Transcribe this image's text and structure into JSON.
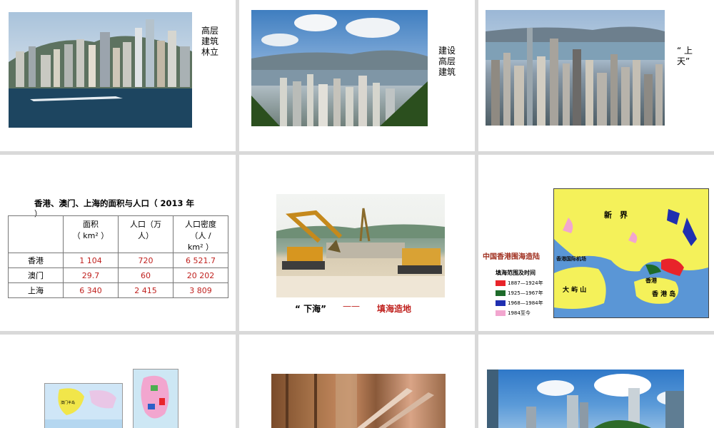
{
  "slide1": {
    "caption": "高层\n建筑\n林立"
  },
  "slide2": {
    "caption": "建设\n高层\n建筑"
  },
  "slide3": {
    "caption": "“ 上\n天”"
  },
  "slide4": {
    "title": "香港、澳门、上海的面积与人口（ 2013 年",
    "title_cont": "）",
    "headers": [
      "",
      "面积\n（ km² ）",
      "人口（万\n人）",
      "人口密度\n（人 /\nkm² ）"
    ],
    "rows": [
      {
        "name": "香港",
        "area": "1 104",
        "pop": "720",
        "density": "6 521.7"
      },
      {
        "name": "澳门",
        "area": "29.7",
        "pop": "60",
        "density": "20 202"
      },
      {
        "name": "上海",
        "area": "6 340",
        "pop": "2 415",
        "density": "3 809"
      }
    ]
  },
  "slide5": {
    "label_left": "“ 下海”",
    "dash": "——",
    "label_right": "填海造地"
  },
  "slide6": {
    "map_title": "中国香港围海造陆",
    "label_xinjie": "新　界",
    "label_dayushan": "大 屿 山",
    "label_airport": "香港国际机场",
    "label_hk": "香港",
    "label_hkisland": "香 港 岛",
    "legend_title": "填海范围及时间",
    "legend": [
      {
        "label": "1887—1924年",
        "color": "#e8242a"
      },
      {
        "label": "1925—1967年",
        "color": "#1e6b2a"
      },
      {
        "label": "1968—1984年",
        "color": "#1f2fb0"
      },
      {
        "label": "1984至今",
        "color": "#f2a6cf"
      }
    ]
  },
  "slide7": {
    "mini_label": "澳门半岛"
  }
}
